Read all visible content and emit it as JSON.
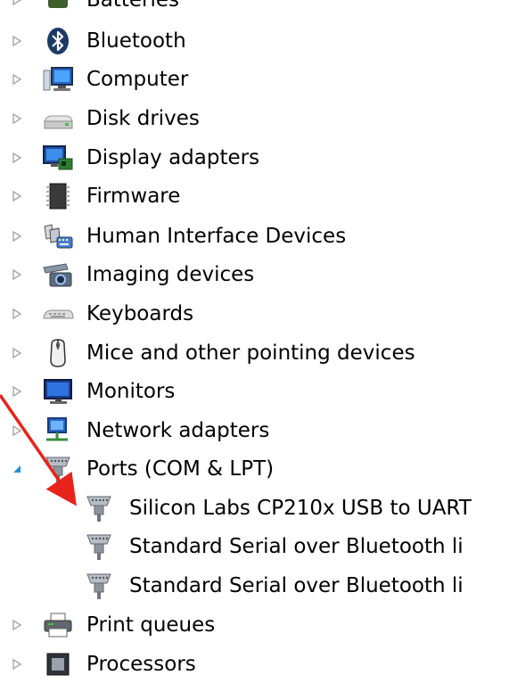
{
  "tree": {
    "top_partial_label": "Batteries",
    "items": [
      {
        "label": "Bluetooth",
        "icon": "bluetooth-icon",
        "expanded": false
      },
      {
        "label": "Computer",
        "icon": "computer-icon",
        "expanded": false
      },
      {
        "label": "Disk drives",
        "icon": "disk-drive-icon",
        "expanded": false
      },
      {
        "label": "Display adapters",
        "icon": "display-adapter-icon",
        "expanded": false
      },
      {
        "label": "Firmware",
        "icon": "firmware-icon",
        "expanded": false
      },
      {
        "label": "Human Interface Devices",
        "icon": "hid-icon",
        "expanded": false
      },
      {
        "label": "Imaging devices",
        "icon": "camera-icon",
        "expanded": false
      },
      {
        "label": "Keyboards",
        "icon": "keyboard-icon",
        "expanded": false
      },
      {
        "label": "Mice and other pointing devices",
        "icon": "mouse-icon",
        "expanded": false
      },
      {
        "label": "Monitors",
        "icon": "monitor-icon",
        "expanded": false
      },
      {
        "label": "Network adapters",
        "icon": "network-adapter-icon",
        "expanded": false
      },
      {
        "label": "Ports (COM & LPT)",
        "icon": "port-icon",
        "expanded": true,
        "children": [
          {
            "label": "Silicon Labs CP210x USB to UART",
            "icon": "port-icon"
          },
          {
            "label": "Standard Serial over Bluetooth li",
            "icon": "port-icon"
          },
          {
            "label": "Standard Serial over Bluetooth li",
            "icon": "port-icon"
          }
        ]
      },
      {
        "label": "Print queues",
        "icon": "printer-icon",
        "expanded": false
      },
      {
        "label": "Processors",
        "icon": "processor-icon",
        "expanded": false
      }
    ]
  },
  "colors": {
    "expander": "#a6a6a6",
    "expanded_arrow": "#1e90d6",
    "annotation_arrow": "#e8231c"
  }
}
